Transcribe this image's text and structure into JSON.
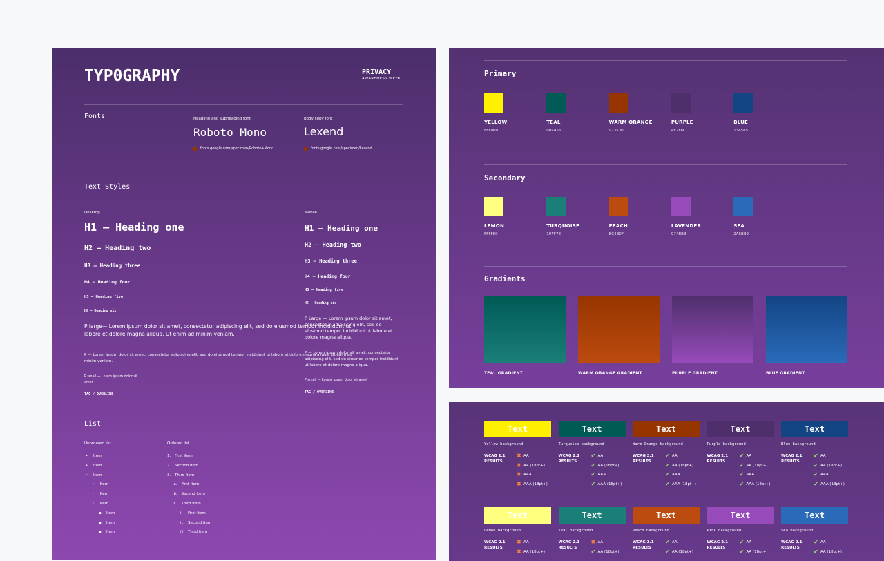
{
  "typography": {
    "title": "TYP0GRAPHY",
    "logo": {
      "line1": "PRIVACY",
      "line2": "AWARENESS WEEK"
    },
    "fonts": {
      "heading": "Fonts",
      "headline": {
        "label": "Headline and subheading font",
        "name": "Roboto Mono",
        "link": "fonts.google.com/specimen/Roboto+Mono"
      },
      "body": {
        "label": "Body copy font",
        "name": "Lexend",
        "link": "fonts.google.com/specimen/Lexend"
      }
    },
    "text_styles": {
      "heading": "Text Styles",
      "desktop": {
        "label": "Desktop",
        "h1": "H1 — Heading one",
        "h2": "H2 — Heading two",
        "h3": "H3 — Heading three",
        "h4": "H4 — Heading four",
        "h5": "H5 — Heading five",
        "h6": "H6 — Heading six",
        "p_large": "P large— Lorem ipsum dolor sit amet, consectetur adipiscing elit, sed do eiusmod tempor incididunt ut labore et dolore magna aliqua. Ut enim ad minim veniam.",
        "p": "P — Lorem ipsum dolor sit amet, consectetur adipiscing elit, sed do eiusmod tempor incididunt ut labore et dolore magna aliqua. Ut enim ad minim veniam.",
        "p_small": "P small  — Lorem ipsum dolor sit amet",
        "tag": "TAG / OVERLINE"
      },
      "mobile": {
        "label": "Mobile",
        "h1": "H1 — Heading one",
        "h2": "H2 — Heading two",
        "h3": "H3 — Heading three",
        "h4": "H4 — Heading four",
        "h5": "H5 — Heading five",
        "h6": "H6 — Heading six",
        "p_large": "P Large — Lorem ipsum dolor sit amet, consectetur adipiscing elit, sed do eiusmod tempor incididunt ut labore et dolore magna aliqua.",
        "p": "P — Lorem ipsum dolor sit amet, consectetur adipiscing elit, sed do eiusmod tempor incididunt ut labore et dolore magna aliqua.",
        "p_small": "P small — Lorem ipsum dolor sit amet",
        "tag": "TAG / OVERLINE"
      }
    },
    "list": {
      "heading": "List",
      "unordered": {
        "label": "Unordered list",
        "items": [
          {
            "m": "•",
            "t": "Item",
            "l": 0
          },
          {
            "m": "•",
            "t": "Item",
            "l": 0
          },
          {
            "m": "•",
            "t": "Item",
            "l": 0
          },
          {
            "m": "◦",
            "t": "Item",
            "l": 1
          },
          {
            "m": "◦",
            "t": "Item",
            "l": 1
          },
          {
            "m": "◦",
            "t": "Item",
            "l": 1
          },
          {
            "m": "▪",
            "t": "Item",
            "l": 2
          },
          {
            "m": "▪",
            "t": "Item",
            "l": 2
          },
          {
            "m": "▪",
            "t": "Item",
            "l": 2
          }
        ]
      },
      "ordered": {
        "label": "Ordered list",
        "items": [
          {
            "m": "1.",
            "t": "First item",
            "l": 0
          },
          {
            "m": "2.",
            "t": "Second item",
            "l": 0
          },
          {
            "m": "3.",
            "t": "Third item",
            "l": 0
          },
          {
            "m": "a.",
            "t": "First item",
            "l": 1
          },
          {
            "m": "b.",
            "t": "Second item",
            "l": 1
          },
          {
            "m": "c.",
            "t": "Third item",
            "l": 1
          },
          {
            "m": "i.",
            "t": "First item",
            "l": 2
          },
          {
            "m": "ii.",
            "t": "Second item",
            "l": 2
          },
          {
            "m": "iii.",
            "t": "Third item",
            "l": 2
          }
        ]
      }
    }
  },
  "colors": {
    "primary": {
      "heading": "Primary",
      "swatches": [
        {
          "name": "YELLOW",
          "hex": "FFF000",
          "color": "#FFF000"
        },
        {
          "name": "TEAL",
          "hex": "005A56",
          "color": "#005A56"
        },
        {
          "name": "WARM ORANGE",
          "hex": "973500",
          "color": "#973500"
        },
        {
          "name": "PURPLE",
          "hex": "4E2F6C",
          "color": "#4E2F6C"
        },
        {
          "name": "BLUE",
          "hex": "134585",
          "color": "#134585"
        }
      ]
    },
    "secondary": {
      "heading": "Secondary",
      "swatches": [
        {
          "name": "LEMON",
          "hex": "FFFF80",
          "color": "#FFFF80"
        },
        {
          "name": "TURQUOISE",
          "hex": "197F78",
          "color": "#197F78"
        },
        {
          "name": "PEACH",
          "hex": "BC4B0F",
          "color": "#BC4B0F"
        },
        {
          "name": "LAVENDER",
          "hex": "974BBB",
          "color": "#974BBB"
        },
        {
          "name": "SEA",
          "hex": "2A6BB9",
          "color": "#2A6BB9"
        }
      ]
    },
    "gradients": {
      "heading": "Gradients",
      "items": [
        {
          "name": "TEAL GRADIENT",
          "from": "#005A56",
          "to": "#1B7F78"
        },
        {
          "name": "WARM ORANGE GRADIENT",
          "from": "#973500",
          "to": "#BC4B0F"
        },
        {
          "name": "PURPLE GRADIENT",
          "from": "#4E2F6C",
          "to": "#974BBB"
        },
        {
          "name": "BLUE GRADIENT",
          "from": "#134585",
          "to": "#2A6BB9"
        }
      ]
    }
  },
  "contrast": {
    "sample": "Text",
    "wcag": "WCAG 2.1",
    "results": "RESULTS",
    "levels": [
      "AA",
      "AA (18pt+)",
      "AAA",
      "AAA (18pt+)"
    ],
    "rows": [
      [
        {
          "bg": "#FFF000",
          "label": "Yellow background",
          "pass": [
            false,
            false,
            false,
            false
          ]
        },
        {
          "bg": "#005A56",
          "label": "Turquoise background",
          "pass": [
            true,
            true,
            true,
            true
          ]
        },
        {
          "bg": "#973500",
          "label": "Warm Orange background",
          "pass": [
            true,
            true,
            true,
            true
          ]
        },
        {
          "bg": "#4E2F6C",
          "label": "Purple background",
          "pass": [
            true,
            true,
            true,
            true
          ]
        },
        {
          "bg": "#134585",
          "label": "Blue background",
          "pass": [
            true,
            true,
            true,
            true
          ]
        }
      ],
      [
        {
          "bg": "#FFFF80",
          "label": "Lemon background",
          "pass": [
            false,
            false
          ]
        },
        {
          "bg": "#197F78",
          "label": "Teal background",
          "pass": [
            false,
            true
          ]
        },
        {
          "bg": "#BC4B0F",
          "label": "Peach background",
          "pass": [
            true,
            true
          ]
        },
        {
          "bg": "#974BBB",
          "label": "Pink background",
          "pass": [
            true,
            true
          ]
        },
        {
          "bg": "#2A6BB9",
          "label": "Sea background",
          "pass": [
            true,
            true
          ]
        }
      ]
    ]
  }
}
